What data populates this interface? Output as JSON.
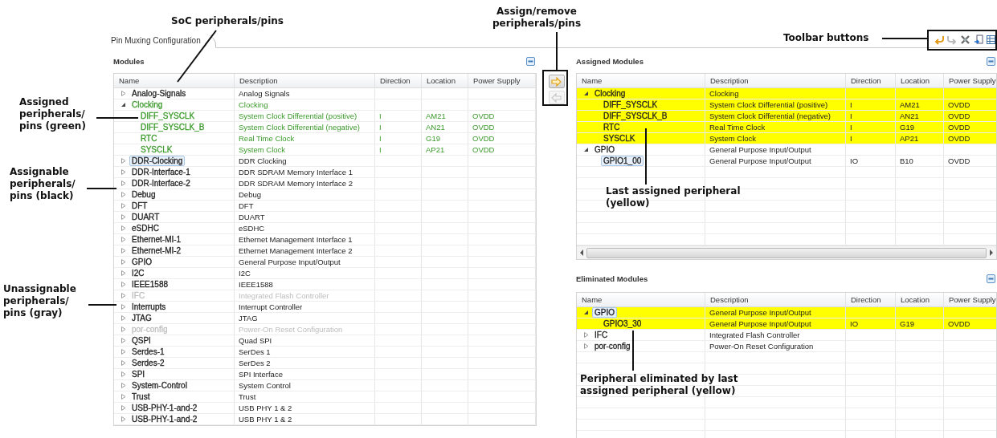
{
  "annotations": [
    {
      "text": "SoC peripherals/pins"
    },
    {
      "text": "Assigned peripherals/ pins (green)"
    },
    {
      "text": "Assignable peripherals/ pins (black)"
    },
    {
      "text": "Unassignable peripherals/ pins (gray)"
    },
    {
      "text": "Assign/remove peripherals/pins"
    },
    {
      "text": "Toolbar buttons"
    },
    {
      "text": "Last assigned peripheral (yellow)"
    },
    {
      "text": "Peripheral eliminated by last assigned peripheral (yellow)"
    }
  ],
  "tab": {
    "label": "Pin Muxing Configuration",
    "selected": true
  },
  "toolbar": [
    {
      "kind": "undo",
      "disabled": false
    },
    {
      "kind": "redo",
      "disabled": true
    },
    {
      "kind": "clear",
      "disabled": false
    },
    {
      "kind": "export",
      "disabled": false
    },
    {
      "kind": "table",
      "disabled": false
    }
  ],
  "assign_buttons": [
    {
      "kind": "assign",
      "disabled": false
    },
    {
      "kind": "remove",
      "disabled": true
    }
  ],
  "modules": {
    "title": "Modules",
    "columns": [
      "Name",
      "Description",
      "Direction",
      "Location",
      "Power Supply"
    ],
    "rows": [
      {
        "name": "Analog-Signals",
        "description": "Analog Signals",
        "color": "#222222",
        "expanded": false,
        "selected": false
      },
      {
        "name": "Clocking",
        "description": "Clocking",
        "color": "#3a9a2a",
        "expanded": true,
        "selected": false,
        "children": [
          {
            "name": "DIFF_SYSCLK",
            "description": "System Clock Differential (positive)",
            "direction": "I",
            "location": "AM21",
            "power_supply": "OVDD",
            "color": "#3a9a2a",
            "selected": false
          },
          {
            "name": "DIFF_SYSCLK_B",
            "description": "System Clock Differential (negative)",
            "direction": "I",
            "location": "AN21",
            "power_supply": "OVDD",
            "color": "#3a9a2a",
            "selected": false
          },
          {
            "name": "RTC",
            "description": "Real Time Clock",
            "direction": "I",
            "location": "G19",
            "power_supply": "OVDD",
            "color": "#3a9a2a",
            "selected": false
          },
          {
            "name": "SYSCLK",
            "description": "System Clock",
            "direction": "I",
            "location": "AP21",
            "power_supply": "OVDD",
            "color": "#3a9a2a",
            "selected": false
          }
        ]
      },
      {
        "name": "DDR-Clocking",
        "description": "DDR Clocking",
        "color": "#222222",
        "expanded": false,
        "selected": true
      },
      {
        "name": "DDR-Interface-1",
        "description": "DDR SDRAM Memory Interface 1",
        "color": "#222222",
        "expanded": false,
        "selected": false
      },
      {
        "name": "DDR-Interface-2",
        "description": "DDR SDRAM Memory Interface 2",
        "color": "#222222",
        "expanded": false,
        "selected": false
      },
      {
        "name": "Debug",
        "description": "Debug",
        "color": "#222222",
        "expanded": false,
        "selected": false
      },
      {
        "name": "DFT",
        "description": "DFT",
        "color": "#222222",
        "expanded": false,
        "selected": false
      },
      {
        "name": "DUART",
        "description": "DUART",
        "color": "#222222",
        "expanded": false,
        "selected": false
      },
      {
        "name": "eSDHC",
        "description": "eSDHC",
        "color": "#222222",
        "expanded": false,
        "selected": false
      },
      {
        "name": "Ethernet-MI-1",
        "description": "Ethernet Management Interface 1",
        "color": "#222222",
        "expanded": false,
        "selected": false
      },
      {
        "name": "Ethernet-MI-2",
        "description": "Ethernet Management Interface 2",
        "color": "#222222",
        "expanded": false,
        "selected": false
      },
      {
        "name": "GPIO",
        "description": "General Purpose Input/Output",
        "color": "#222222",
        "expanded": false,
        "selected": false
      },
      {
        "name": "I2C",
        "description": "I2C",
        "color": "#222222",
        "expanded": false,
        "selected": false
      },
      {
        "name": "IEEE1588",
        "description": "IEEE1588",
        "color": "#222222",
        "expanded": false,
        "selected": false
      },
      {
        "name": "IFC",
        "description": "Integrated Flash Controller",
        "color": "#bdbdbd",
        "expanded": false,
        "selected": false
      },
      {
        "name": "Interrupts",
        "description": "Interrupt Controller",
        "color": "#222222",
        "expanded": false,
        "selected": false
      },
      {
        "name": "JTAG",
        "description": "JTAG",
        "color": "#222222",
        "expanded": false,
        "selected": false
      },
      {
        "name": "por-config",
        "description": "Power-On Reset Configuration",
        "color": "#bdbdbd",
        "expanded": false,
        "selected": false
      },
      {
        "name": "QSPI",
        "description": "Quad SPI",
        "color": "#222222",
        "expanded": false,
        "selected": false
      },
      {
        "name": "Serdes-1",
        "description": "SerDes 1",
        "color": "#222222",
        "expanded": false,
        "selected": false
      },
      {
        "name": "Serdes-2",
        "description": "SerDes 2",
        "color": "#222222",
        "expanded": false,
        "selected": false
      },
      {
        "name": "SPI",
        "description": "SPI Interface",
        "color": "#222222",
        "expanded": false,
        "selected": false
      },
      {
        "name": "System-Control",
        "description": "System Control",
        "color": "#222222",
        "expanded": false,
        "selected": false
      },
      {
        "name": "Trust",
        "description": "Trust",
        "color": "#222222",
        "expanded": false,
        "selected": false
      },
      {
        "name": "USB-PHY-1-and-2",
        "description": "USB PHY 1 & 2",
        "color": "#222222",
        "expanded": false,
        "selected": false
      },
      {
        "name": "USB-PHY-1-and-2",
        "description": "USB PHY 1 & 2",
        "color": "#222222",
        "expanded": false,
        "selected": false
      }
    ]
  },
  "assigned": {
    "title": "Assigned Modules",
    "columns": [
      "Name",
      "Description",
      "Direction",
      "Location",
      "Power Supply"
    ],
    "rows": [
      {
        "name": "Clocking",
        "description": "Clocking",
        "expanded": true,
        "highlighted": true,
        "selected": false,
        "children": [
          {
            "name": "DIFF_SYSCLK",
            "description": "System Clock Differential (positive)",
            "direction": "I",
            "location": "AM21",
            "power_supply": "OVDD",
            "highlighted": true,
            "selected": false
          },
          {
            "name": "DIFF_SYSCLK_B",
            "description": "System Clock Differential (negative)",
            "direction": "I",
            "location": "AN21",
            "power_supply": "OVDD",
            "highlighted": true,
            "selected": false
          },
          {
            "name": "RTC",
            "description": "Real Time Clock",
            "direction": "I",
            "location": "G19",
            "power_supply": "OVDD",
            "highlighted": true,
            "selected": false
          },
          {
            "name": "SYSCLK",
            "description": "System Clock",
            "direction": "I",
            "location": "AP21",
            "power_supply": "OVDD",
            "highlighted": true,
            "selected": false
          }
        ]
      },
      {
        "name": "GPIO",
        "description": "General Purpose Input/Output",
        "expanded": true,
        "highlighted": false,
        "selected": false,
        "children": [
          {
            "name": "GPIO1_00",
            "description": "General Purpose Input/Output",
            "direction": "IO",
            "location": "B10",
            "power_supply": "OVDD",
            "highlighted": false,
            "selected": true
          }
        ]
      }
    ]
  },
  "eliminated": {
    "title": "Eliminated Modules",
    "columns": [
      "Name",
      "Description",
      "Direction",
      "Location",
      "Power Supply"
    ],
    "rows": [
      {
        "name": "GPIO",
        "description": "General Purpose Input/Output",
        "expanded": true,
        "highlighted": true,
        "selected": true,
        "children": [
          {
            "name": "GPIO3_30",
            "description": "General Purpose Input/Output",
            "direction": "IO",
            "location": "G19",
            "power_supply": "OVDD",
            "highlighted": true,
            "selected": false
          }
        ]
      },
      {
        "name": "IFC",
        "description": "Integrated Flash Controller",
        "expanded": false,
        "highlighted": false,
        "selected": false
      },
      {
        "name": "por-config",
        "description": "Power-On Reset Configuration",
        "expanded": false,
        "highlighted": false,
        "selected": false
      }
    ]
  }
}
